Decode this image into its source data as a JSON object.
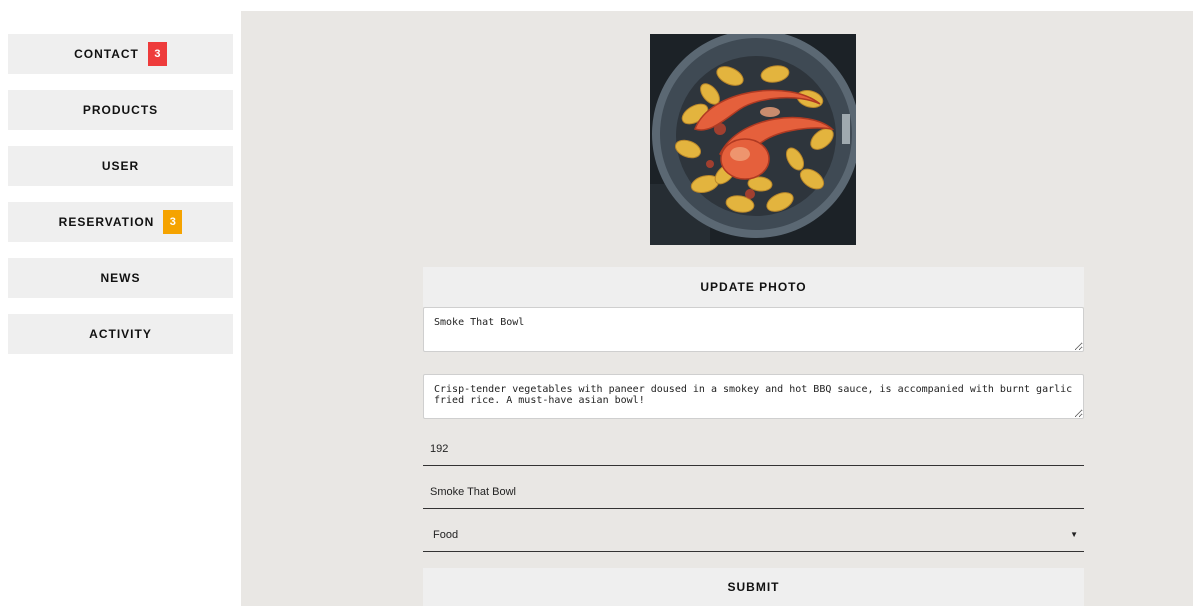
{
  "sidebar": {
    "items": [
      {
        "label": "CONTACT",
        "badge": "3",
        "badge_color": "#ee3b3b"
      },
      {
        "label": "PRODUCTS"
      },
      {
        "label": "USER"
      },
      {
        "label": "RESERVATION",
        "badge": "3",
        "badge_color": "#f5a300"
      },
      {
        "label": "NEWS"
      },
      {
        "label": "ACTIVITY"
      }
    ]
  },
  "form": {
    "photo_alt": "shrimp pasta bowl",
    "update_photo_label": "UPDATE PHOTO",
    "name_value": "Smoke That Bowl",
    "description_value": "Crisp-tender vegetables with paneer doused in a smokey and hot BBQ sauce, is accompanied with burnt garlic fried rice. A must-have asian bowl!",
    "price_value": "192",
    "alt_name_value": "Smoke That Bowl",
    "category_selected": "Food",
    "submit_label": "SUBMIT"
  },
  "colors": {
    "badge_red": "#ee3b3b",
    "badge_orange": "#f5a300",
    "panel_bg": "#e9e7e4",
    "button_bg": "#efefef"
  }
}
